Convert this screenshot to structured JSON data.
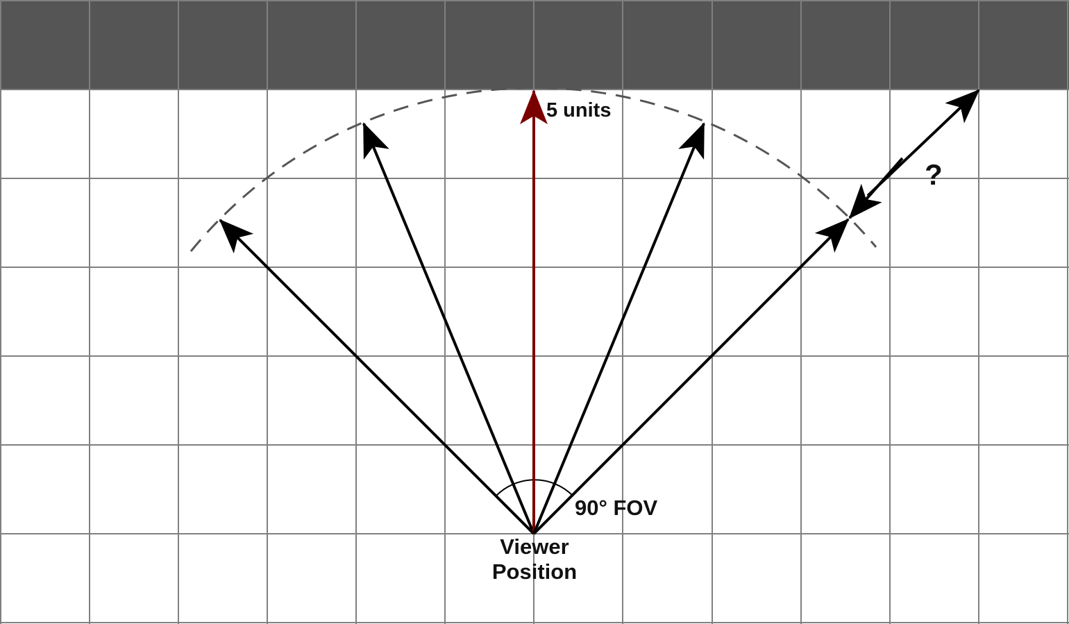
{
  "labels": {
    "distance": "5 units",
    "fov": "90° FOV",
    "unknown": "?",
    "viewer_line1": "Viewer",
    "viewer_line2": "Position"
  },
  "colors": {
    "wall": "#555555",
    "grid": "#808080",
    "ray": "#000000",
    "center_ray": "#7a0000",
    "arc": "#555555",
    "background": "#ffffff"
  },
  "diagram": {
    "grid_columns": 12,
    "grid_rows": 7,
    "wall_rows": 1,
    "fov_degrees": 90,
    "ray_count": 5,
    "ray_length_units": 5
  }
}
